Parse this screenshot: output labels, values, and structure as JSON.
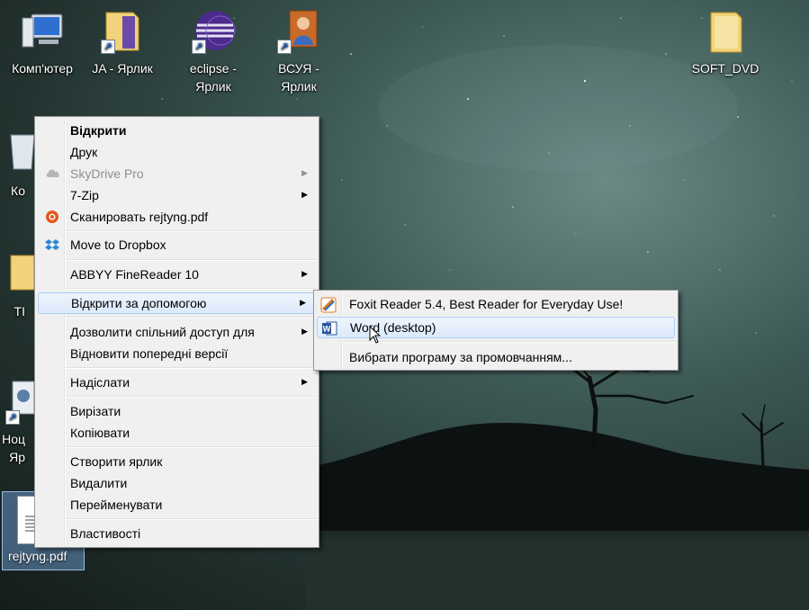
{
  "desktop": {
    "icons": [
      {
        "label": "Комп'ютер"
      },
      {
        "label": "JA - Ярлик"
      },
      {
        "label": "eclipse -\nЯрлик"
      },
      {
        "label": "ВСУЯ -\nЯрлик"
      },
      {
        "label": "SOFT_DVD"
      },
      {
        "label": "Ко"
      },
      {
        "label": "TI"
      },
      {
        "label": "Ноц\nЯр"
      },
      {
        "label": "rejtyng.pdf"
      }
    ]
  },
  "context_menu": {
    "items": [
      {
        "label": "Відкрити",
        "bold": true
      },
      {
        "label": "Друк"
      },
      {
        "label": "SkyDrive Pro",
        "disabled": true,
        "submenu": true,
        "icon": "cloud-icon"
      },
      {
        "label": "7-Zip",
        "submenu": true
      },
      {
        "label": "Сканировать rejtyng.pdf",
        "icon": "antivirus-icon"
      },
      {
        "label": "Move to Dropbox",
        "icon": "dropbox-icon"
      },
      {
        "label": "ABBYY FineReader 10",
        "submenu": true
      },
      {
        "label": "Відкрити за допомогою",
        "submenu": true,
        "highlighted": true
      },
      {
        "label": "Дозволити спільний доступ для",
        "submenu": true
      },
      {
        "label": "Відновити попередні версії"
      },
      {
        "label": "Надіслати",
        "submenu": true
      },
      {
        "label": "Вирізати"
      },
      {
        "label": "Копіювати"
      },
      {
        "label": "Створити ярлик"
      },
      {
        "label": "Видалити"
      },
      {
        "label": "Перейменувати"
      },
      {
        "label": "Властивості"
      }
    ]
  },
  "open_with_submenu": {
    "items": [
      {
        "label": "Foxit Reader 5.4, Best Reader for Everyday Use!",
        "icon": "foxit-icon"
      },
      {
        "label": "Word (desktop)",
        "icon": "word-icon",
        "highlighted": true
      },
      {
        "label": "Вибрати програму за промовчанням..."
      }
    ]
  },
  "submenu_arrow": "▶"
}
